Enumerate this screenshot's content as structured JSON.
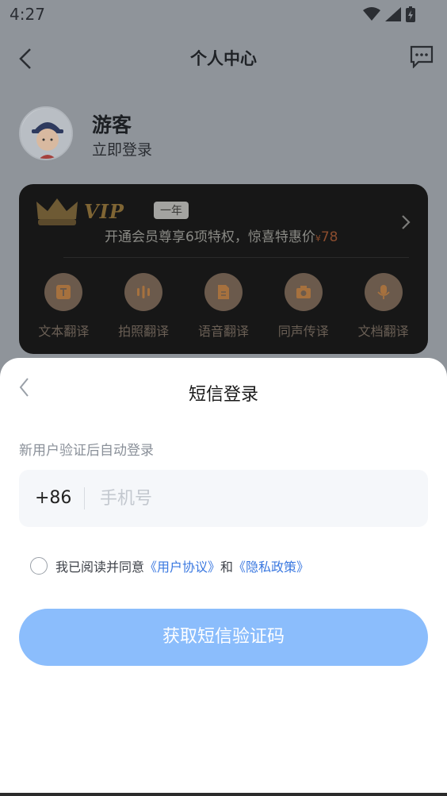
{
  "status_bar": {
    "time": "4:27"
  },
  "nav": {
    "title": "个人中心"
  },
  "profile": {
    "name": "游客",
    "login_label": "立即登录"
  },
  "vip": {
    "logo_text": "VIP",
    "badge": "一年",
    "description": "开通会员尊享6项特权，惊喜特惠价",
    "price_symbol": "¥",
    "price": "78",
    "features": [
      {
        "label": "文本翻译",
        "icon": "text-translate-icon"
      },
      {
        "label": "拍照翻译",
        "icon": "camera-translate-icon"
      },
      {
        "label": "语音翻译",
        "icon": "voice-translate-icon"
      },
      {
        "label": "同声传译",
        "icon": "simultaneous-interpret-icon"
      },
      {
        "label": "文档翻译",
        "icon": "document-translate-icon"
      }
    ]
  },
  "sheet": {
    "title": "短信登录",
    "hint": "新用户验证后自动登录",
    "country_code": "+86",
    "phone_placeholder": "手机号",
    "agree_prefix": "我已阅读并同意",
    "user_agreement": "《用户协议》",
    "agree_and": "和",
    "privacy_policy": "《隐私政策》",
    "submit_label": "获取短信验证码"
  },
  "colors": {
    "accent": "#3a78e0",
    "button_disabled": "#8bbdfc",
    "overlay": "#8f949a"
  }
}
